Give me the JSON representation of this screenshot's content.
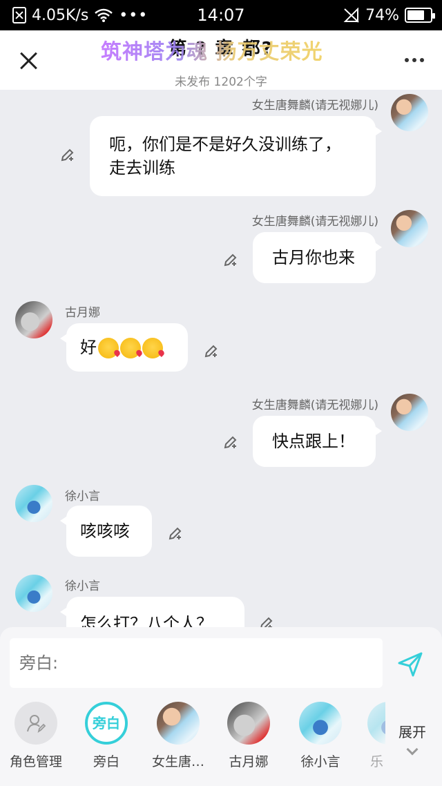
{
  "status_bar": {
    "speed": "4.05K/s",
    "time": "14:07",
    "battery": "74%",
    "battery_level": 0.74
  },
  "header": {
    "title": "第 ? 章 都?",
    "subtitle": "未发布 1202个字",
    "overlay_banner": "筑神塔为魂 扬万丈荣光"
  },
  "messages": [
    {
      "sender": "女生唐舞麟(请无视娜儿)",
      "text": "呃，你们是不是好久没训练了，走去训练",
      "side": "right",
      "avatar": "tang-avatar"
    },
    {
      "sender": "女生唐舞麟(请无视娜儿)",
      "text": "古月你也来",
      "side": "right",
      "avatar": "tang-avatar"
    },
    {
      "sender": "古月娜",
      "text": "好",
      "side": "left",
      "avatar": "gu-avatar"
    },
    {
      "sender": "女生唐舞麟(请无视娜儿)",
      "text": "快点跟上！",
      "side": "right",
      "avatar": "tang-avatar"
    },
    {
      "sender": "徐小言",
      "text": "咳咳咳",
      "side": "left",
      "avatar": "xu-avatar"
    },
    {
      "sender": "徐小言",
      "text": "怎么打？八个人？",
      "side": "left",
      "avatar": "xu-avatar"
    }
  ],
  "input": {
    "placeholder": "旁白:"
  },
  "roles": [
    {
      "label": "角色管理",
      "icon": "person-edit-icon"
    },
    {
      "label": "旁白",
      "circle_text": "旁白"
    },
    {
      "label": "女生唐…"
    },
    {
      "label": "古月娜"
    },
    {
      "label": "徐小言"
    },
    {
      "label": "乐"
    }
  ],
  "expand_label": "展开",
  "colors": {
    "accent": "#35cfd9",
    "background": "#ecedf1",
    "bubble": "#ffffff"
  }
}
